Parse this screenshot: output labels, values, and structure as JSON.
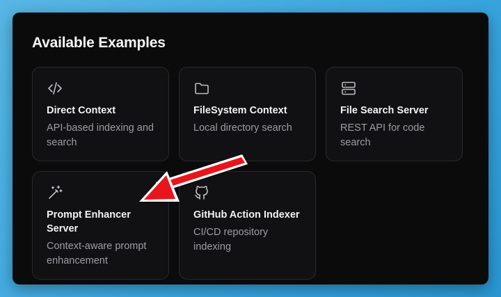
{
  "panel": {
    "title": "Available Examples"
  },
  "cards": [
    {
      "title": "Direct Context",
      "description": "API-based indexing and search",
      "icon": "code-icon"
    },
    {
      "title": "FileSystem Context",
      "description": "Local directory search",
      "icon": "folder-icon"
    },
    {
      "title": "File Search Server",
      "description": "REST API for code search",
      "icon": "server-icon"
    },
    {
      "title": "Prompt Enhancer Server",
      "description": "Context-aware prompt enhancement",
      "icon": "magic-wand-icon"
    },
    {
      "title": "GitHub Action Indexer",
      "description": "CI/CD repository indexing",
      "icon": "github-icon"
    }
  ],
  "annotation": {
    "arrow_color": "#e8141b",
    "points_to": "Prompt Enhancer Server"
  },
  "colors": {
    "background": "#3aa6de",
    "panel": "#0b0b0c",
    "card": "#111113",
    "card_border": "#2a2a2d"
  }
}
